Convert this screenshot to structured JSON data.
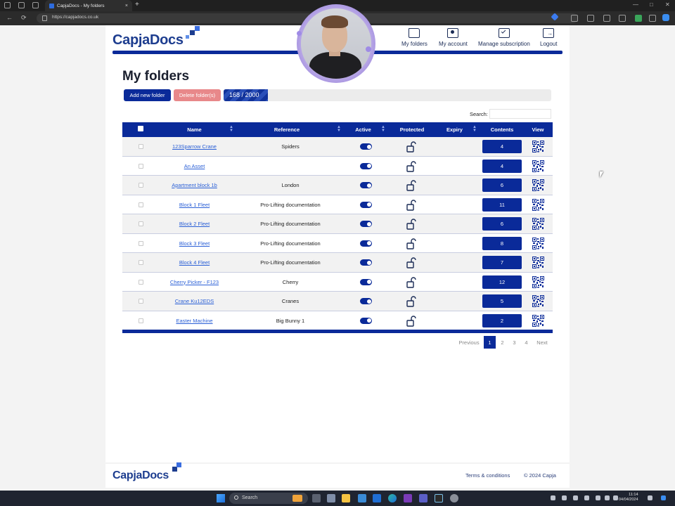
{
  "browser": {
    "tab_title": "CapjaDocs - My folders",
    "tab_close": "×",
    "new_tab": "+",
    "url": "https://capjadocs.co.uk",
    "back": "←",
    "refresh": "⟳",
    "minimize": "—",
    "maximize": "□",
    "close": "✕"
  },
  "header": {
    "logo_text": "CapjaDocs",
    "nav": [
      {
        "label": "My folders",
        "icon": "folder-icon"
      },
      {
        "label": "My account",
        "icon": "account-card-icon"
      },
      {
        "label": "Manage subscription",
        "icon": "calendar-check-icon"
      },
      {
        "label": "Logout",
        "icon": "logout-icon"
      }
    ]
  },
  "main": {
    "title": "My folders",
    "add_button": "Add new folder",
    "delete_button": "Delete folder(s)",
    "usage_label": "168 / 2000",
    "usage_used": 168,
    "usage_total": 2000,
    "search_label": "Search:",
    "search_value": ""
  },
  "table": {
    "columns": [
      "Name",
      "Reference",
      "Active",
      "Protected",
      "Expiry",
      "Contents",
      "View"
    ],
    "rows": [
      {
        "name": "123Sparrow Crane",
        "reference": "Spiders",
        "active": true,
        "contents": "4"
      },
      {
        "name": "An Asset",
        "reference": "",
        "active": true,
        "contents": "4"
      },
      {
        "name": "Apartment block 1b",
        "reference": "London",
        "active": true,
        "contents": "6"
      },
      {
        "name": "Block 1 Fleet",
        "reference": "Pro-Lifting documentation",
        "active": true,
        "contents": "11"
      },
      {
        "name": "Block 2 Fleet",
        "reference": "Pro-Lifting documentation",
        "active": true,
        "contents": "6"
      },
      {
        "name": "Block 3 Fleet",
        "reference": "Pro-Lifting documentation",
        "active": true,
        "contents": "8"
      },
      {
        "name": "Block 4 Fleet",
        "reference": "Pro-Lifting documentation",
        "active": true,
        "contents": "7"
      },
      {
        "name": "Cherry Picker - F123",
        "reference": "Cherry",
        "active": true,
        "contents": "12"
      },
      {
        "name": "Crane Ku12EDS",
        "reference": "Cranes",
        "active": true,
        "contents": "5"
      },
      {
        "name": "Easter Machine",
        "reference": "Big Bunny 1",
        "active": true,
        "contents": "2"
      }
    ]
  },
  "pagination": {
    "previous": "Previous",
    "pages": [
      "1",
      "2",
      "3",
      "4"
    ],
    "current": "1",
    "next": "Next"
  },
  "footer": {
    "logo_text": "CapjaDocs",
    "terms": "Terms & conditions",
    "copyright": "© 2024 Capja"
  },
  "taskbar": {
    "search_label": "Search",
    "time": "11:14",
    "date": "04/04/2024"
  },
  "colors": {
    "brand_navy": "#0a2a99",
    "delete_pink": "#e8888a",
    "link_blue": "#2a5fd6",
    "logo_accent": "#3a6de0"
  }
}
